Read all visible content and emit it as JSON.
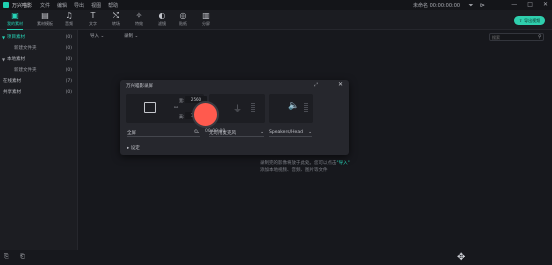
{
  "titlebar": {
    "app_name": "万兴喵影",
    "menu": [
      "文件",
      "编辑",
      "导出",
      "视图",
      "帮助"
    ],
    "right_title": "未命名 00:00:00:00",
    "window_controls": [
      "—",
      "□",
      "✕"
    ]
  },
  "toolbar": {
    "tools": [
      {
        "label": "我的素材",
        "icon": "folder-icon"
      },
      {
        "label": "素材模板",
        "icon": "template-icon"
      },
      {
        "label": "音频",
        "icon": "music-icon"
      },
      {
        "label": "文字",
        "icon": "text-icon"
      },
      {
        "label": "转场",
        "icon": "transition-icon"
      },
      {
        "label": "特效",
        "icon": "effects-icon"
      },
      {
        "label": "滤镜",
        "icon": "filter-icon"
      },
      {
        "label": "贴纸",
        "icon": "sticker-icon"
      },
      {
        "label": "分屏",
        "icon": "split-screen-icon"
      }
    ],
    "export_label": "导出视频"
  },
  "sidebar": {
    "items": [
      {
        "label": "项目素材",
        "count": "(0)",
        "arrow": "▼"
      },
      {
        "label": "新建文件夹",
        "count": "(0)",
        "arrow": ""
      },
      {
        "label": "本地素材",
        "count": "(0)",
        "arrow": "▼"
      },
      {
        "label": "新建文件夹",
        "count": "(0)",
        "arrow": ""
      },
      {
        "label": "在线素材",
        "count": "(7)",
        "arrow": ""
      },
      {
        "label": "共享素材",
        "count": "(0)",
        "arrow": ""
      }
    ]
  },
  "filterbar": {
    "import_label": "导入",
    "record_label": "录制",
    "search_placeholder": "搜索"
  },
  "dialog": {
    "title": "万兴喵影录屏",
    "width_label": "宽:",
    "width_value": "2560",
    "height_label": "高:",
    "height_value": "1440",
    "area_select": "全屏",
    "mic_select": "无可用麦克风",
    "speaker_select": "Speakers/Head",
    "timer": "00:00:00",
    "settings_label": "设定"
  },
  "hint": {
    "line1_pre": "录制完的影像将放于此处。您可以点击",
    "line1_hl": "\"导入\"",
    "line2": "添加本地视频、音频、图片等文件"
  },
  "colors": {
    "accent": "#26d3b6",
    "record": "#ff5a4e",
    "background": "#17181d"
  }
}
